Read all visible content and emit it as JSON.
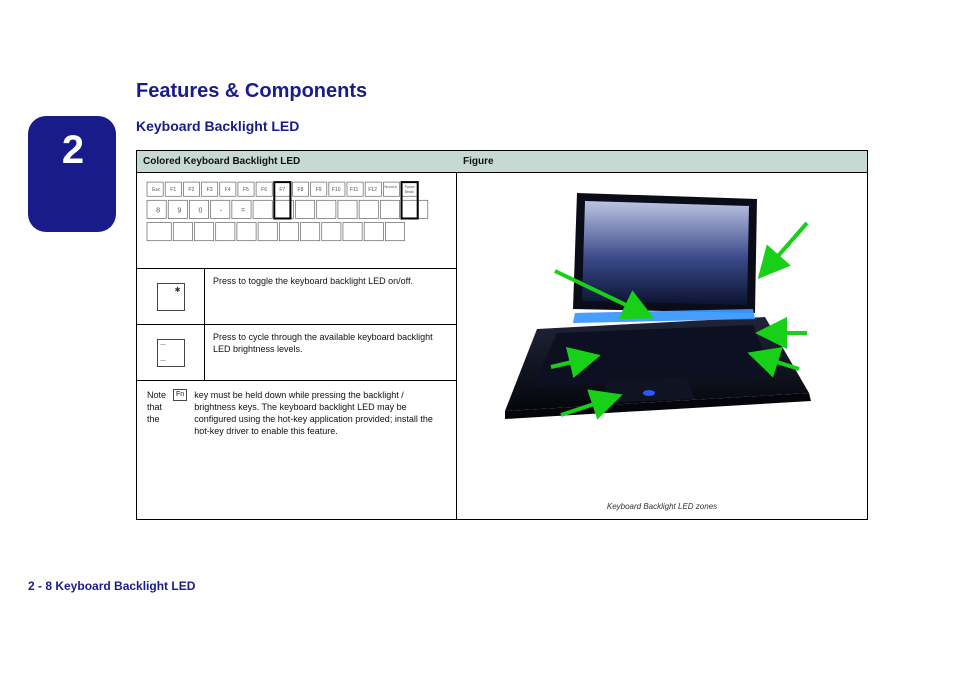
{
  "page": {
    "tab_big": "2",
    "footer": "2 - 8  Keyboard Backlight LED"
  },
  "chapter": "Features & Components",
  "section_heading": "Keyboard Backlight LED",
  "table": {
    "header_left": "Colored Keyboard Backlight LED",
    "header_right": "Figure",
    "r1": "Function key row with NumLk / (backlight toggle) and / (backlight brightness) highlighted",
    "r2_icon_top": "",
    "r2_icon_bot": "",
    "r2_text": "Press to toggle the keyboard backlight LED on/off.",
    "r3_icon_top": "—",
    "r3_icon_bot": "—",
    "r3_text": "Press to cycle through the available keyboard backlight LED brightness levels.",
    "r4_prefix": "Note that the ",
    "r4_key": "Fn",
    "r4_suffix": " key must be held down while pressing the backlight / brightness keys. The keyboard backlight LED may be configured using the hot-key application provided; install the hot-key driver to enable this feature.",
    "fig_caption": "Keyboard Backlight LED zones"
  }
}
